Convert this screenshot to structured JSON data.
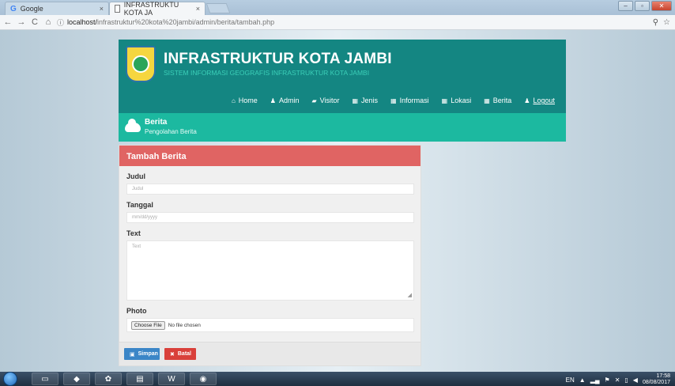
{
  "browser": {
    "tabs": [
      {
        "title": "Google",
        "icon": "google-icon"
      },
      {
        "title": "INFRASTRUKTU KOTA JA",
        "icon": "page-icon"
      }
    ],
    "url_host": "localhost/",
    "url_path": "infrastruktur%20kota%20jambi/admin/berita/tambah.php"
  },
  "site": {
    "title": "INFRASTRUKTUR KOTA JAMBI",
    "subtitle": "SISTEM INFORMASI GEOGRAFIS INFRASTRUKTUR KOTA JAMBI"
  },
  "nav": [
    {
      "label": "Home",
      "icon": "home-icon"
    },
    {
      "label": "Admin",
      "icon": "user-icon"
    },
    {
      "label": "Visitor",
      "icon": "image-icon"
    },
    {
      "label": "Jenis",
      "icon": "grid-icon"
    },
    {
      "label": "Informasi",
      "icon": "grid-icon"
    },
    {
      "label": "Lokasi",
      "icon": "grid-icon"
    },
    {
      "label": "Berita",
      "icon": "grid-icon"
    },
    {
      "label": "Logout",
      "icon": "user-icon"
    }
  ],
  "breadcrumb": {
    "title": "Berita",
    "subtitle": "Pengolahan Berita"
  },
  "form": {
    "heading": "Tambah Berita",
    "judul_label": "Judul",
    "judul_placeholder": "Judul",
    "tanggal_label": "Tanggal",
    "tanggal_placeholder": "mm/dd/yyyy",
    "text_label": "Text",
    "text_placeholder": "Text",
    "photo_label": "Photo",
    "file_button": "Choose File",
    "file_status": "No file chosen",
    "save_label": "Simpan",
    "cancel_label": "Batal"
  },
  "taskbar": {
    "language": "EN",
    "time": "17:58",
    "date": "08/08/2017"
  }
}
